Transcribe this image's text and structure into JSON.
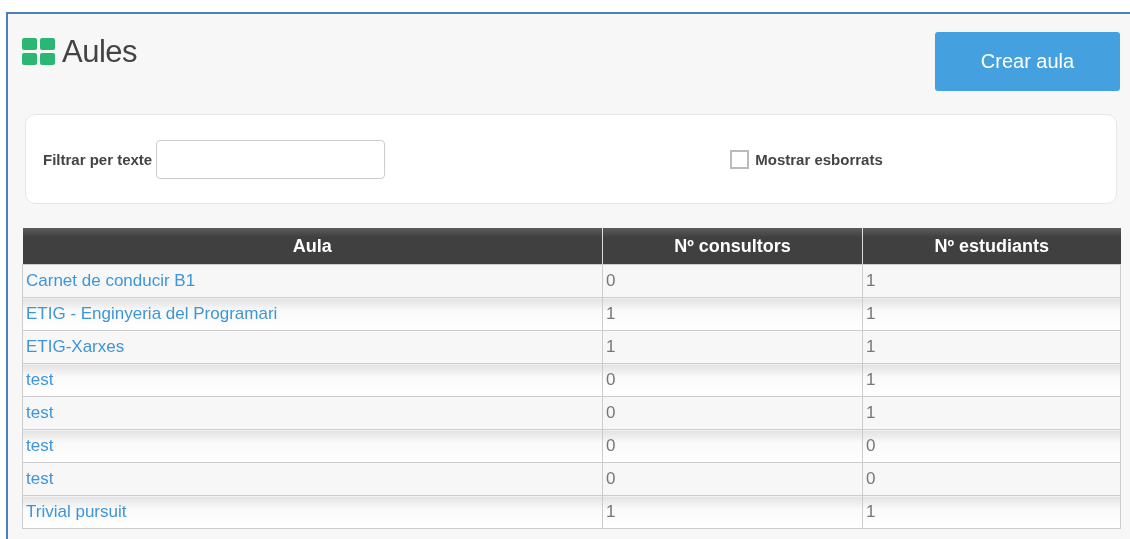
{
  "page": {
    "title": "Aules",
    "create_button": "Crear aula"
  },
  "filter": {
    "label": "Filtrar per texte",
    "show_deleted": {
      "label": "Mostrar esborrats",
      "checked": false
    }
  },
  "table": {
    "columns": [
      "Aula",
      "Nº consultors",
      "Nº estudiants"
    ],
    "rows": [
      [
        "Carnet de conducir B1",
        "0",
        "1"
      ],
      [
        "ETIG - Enginyeria del Programari",
        "1",
        "1"
      ],
      [
        "ETIG-Xarxes",
        "1",
        "1"
      ],
      [
        "test",
        "0",
        "1"
      ],
      [
        "test",
        "0",
        "1"
      ],
      [
        "test",
        "0",
        "0"
      ],
      [
        "test",
        "0",
        "0"
      ],
      [
        "Trivial pursuit",
        "1",
        "1"
      ]
    ]
  }
}
